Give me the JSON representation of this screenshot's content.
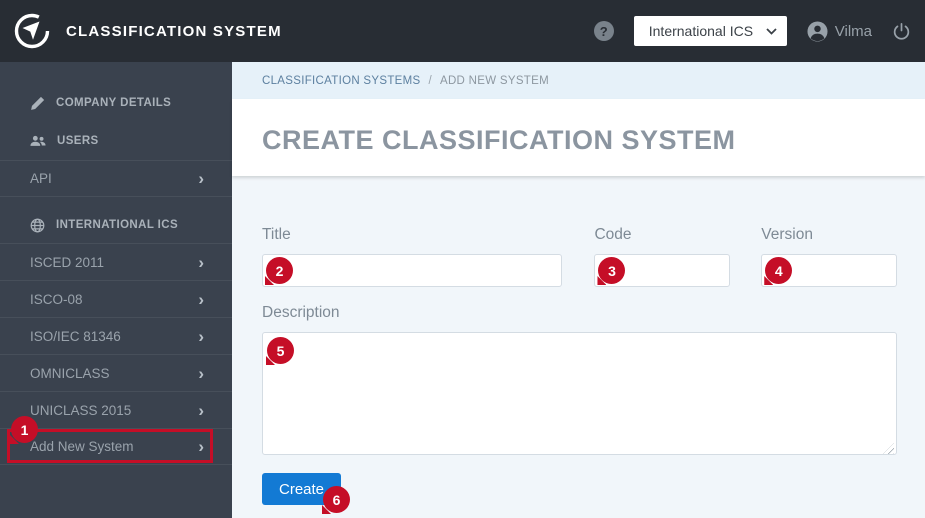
{
  "header": {
    "app_title": "CLASSIFICATION SYSTEM",
    "environment_select": {
      "value": "International ICS"
    },
    "user": {
      "name": "Vilma"
    }
  },
  "icons": {
    "help_glyph": "?",
    "chevron_right": "›"
  },
  "breadcrumb": {
    "section": "CLASSIFICATION SYSTEMS",
    "separator": "/",
    "current": "ADD NEW SYSTEM"
  },
  "sidebar": {
    "items": [
      {
        "label": "COMPANY DETAILS",
        "icon": "pencil-icon"
      },
      {
        "label": "USERS",
        "icon": "users-icon"
      },
      {
        "label": "API",
        "has_chevron": true
      },
      {
        "label": "INTERNATIONAL ICS",
        "icon": "globe-icon"
      },
      {
        "label": "ISCED 2011",
        "has_chevron": true
      },
      {
        "label": "ISCO-08",
        "has_chevron": true
      },
      {
        "label": "ISO/IEC 81346",
        "has_chevron": true
      },
      {
        "label": "OMNICLASS",
        "has_chevron": true
      },
      {
        "label": "UNICLASS 2015",
        "has_chevron": true
      },
      {
        "label": "Add New System",
        "has_chevron": true,
        "annotation": "1"
      }
    ]
  },
  "main": {
    "page_title": "CREATE CLASSIFICATION SYSTEM",
    "form": {
      "title": {
        "label": "Title",
        "value": ""
      },
      "code": {
        "label": "Code",
        "value": ""
      },
      "version": {
        "label": "Version",
        "value": ""
      },
      "description": {
        "label": "Description",
        "value": ""
      },
      "create_button_label": "Create"
    }
  },
  "annotations": {
    "badges": [
      "1",
      "2",
      "3",
      "4",
      "5",
      "6"
    ],
    "highlight_color": "#c50e27"
  },
  "colors": {
    "topbar_bg": "#282d34",
    "sidebar_bg": "#3a424e",
    "breadcrumb_bg": "#e6f1f9",
    "content_bg": "#f1f6fa",
    "primary_button_bg": "#137ad4",
    "annotation_red": "#c50e27"
  }
}
